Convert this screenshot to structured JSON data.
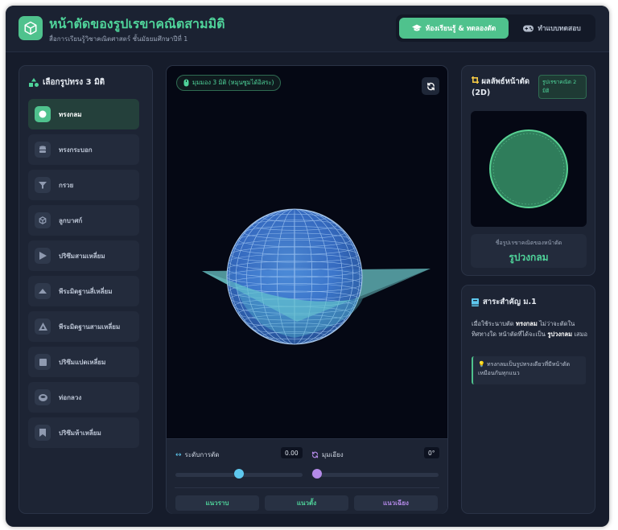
{
  "header": {
    "title": "หน้าตัดของรูปเรขาคณิตสามมิติ",
    "subtitle": "สื่อการเรียนรู้วิชาคณิตศาสตร์ ชั้นมัธยมศึกษาปีที่ 1",
    "modes": [
      {
        "label": "ห้องเรียนรู้ & ทดลองตัด",
        "icon": "graduation-cap-icon",
        "active": true
      },
      {
        "label": "ทำแบบทดสอบ",
        "icon": "gamepad-icon",
        "active": false
      }
    ]
  },
  "sidebar": {
    "heading": "เลือกรูปทรง 3 มิติ",
    "items": [
      {
        "label": "ทรงกลม",
        "icon": "sphere-icon",
        "active": true
      },
      {
        "label": "ทรงกระบอก",
        "icon": "cylinder-icon",
        "active": false
      },
      {
        "label": "กรวย",
        "icon": "cone-icon",
        "active": false
      },
      {
        "label": "ลูกบาศก์",
        "icon": "cube-icon",
        "active": false
      },
      {
        "label": "ปริซึมสามเหลี่ยม",
        "icon": "triangular-prism-icon",
        "active": false
      },
      {
        "label": "พีระมิดฐานสี่เหลี่ยม",
        "icon": "square-pyramid-icon",
        "active": false
      },
      {
        "label": "พีระมิดฐานสามเหลี่ยม",
        "icon": "triangular-pyramid-icon",
        "active": false
      },
      {
        "label": "ปริซึมแปดเหลี่ยม",
        "icon": "octagonal-prism-icon",
        "active": false
      },
      {
        "label": "ท่อกลวง",
        "icon": "tube-icon",
        "active": false
      },
      {
        "label": "ปริซึมห้าเหลี่ยม",
        "icon": "pentagonal-prism-icon",
        "active": false
      }
    ]
  },
  "viewer": {
    "badge": "มุมมอง 3 มิติ (หมุนซูมได้อิสระ)",
    "cut_level_label": "ระดับการตัด",
    "cut_level_value": "0.00",
    "cut_level": 0.5,
    "tilt_label": "มุมเอียง",
    "tilt_value": "0°",
    "tilt": 0.0,
    "directions": [
      {
        "label": "แนวราบ",
        "color": "#4fd39a"
      },
      {
        "label": "แนวตั้ง",
        "color": "#4fd39a"
      },
      {
        "label": "แนวเฉียง",
        "color": "#b48ae8"
      }
    ]
  },
  "result": {
    "title": "ผลลัพธ์หน้าตัด (2D)",
    "badge": "รูปเรขาคณิต 2 มิติ",
    "caption": "ชื่อรูปเรขาคณิตของหน้าตัด",
    "name": "รูปวงกลม"
  },
  "notes": {
    "heading": "สาระสำคัญ ม.1",
    "p1": "เมื่อใช้ระนาบตัด ",
    "b1": "ทรงกลม",
    "p2": " ไม่ว่าจะตัดในทิศทางใด หน้าตัดที่ได้จะเป็น ",
    "b2": "รูปวงกลม",
    "p3": " เสมอ",
    "tip": "ทรงกลมเป็นรูปทรงเดียวที่มีหน้าตัดเหมือนกันทุกแนว"
  },
  "colors": {
    "accent": "#4fc28d",
    "accent_text": "#4fd39a",
    "purple": "#b48ae8",
    "cyan": "#5ec8ee"
  }
}
